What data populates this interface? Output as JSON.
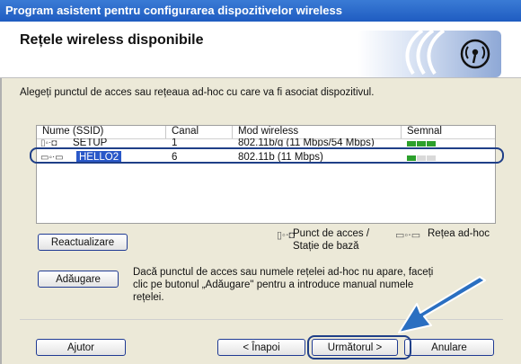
{
  "window": {
    "title": "Program asistent pentru configurarea dispozitivelor wireless"
  },
  "header": {
    "title": "Rețele wireless disponibile",
    "logo_icon": "wifi-broadcast-icon"
  },
  "instruction": "Alegeți punctul de acces sau rețeaua ad-hoc cu care va fi asociat dispozitivul.",
  "network_list": {
    "columns": [
      "Nume (SSID)",
      "Canal",
      "Mod wireless",
      "Semnal"
    ],
    "rows": [
      {
        "ssid": "SETUP",
        "channel": "1",
        "mode": "802.11b/g (11 Mbps/54 Mbps)",
        "signal_bars": 3,
        "type_icon": "access-point-icon"
      },
      {
        "ssid": "HELLO2",
        "channel": "6",
        "mode": "802.11b (11 Mbps)",
        "signal_bars": 1,
        "type_icon": "ad-hoc-icon",
        "selected": true
      }
    ]
  },
  "buttons": {
    "refresh": "Reactualizare",
    "add": "Adăugare",
    "help": "Ajutor",
    "back": "< Înapoi",
    "next": "Următorul >",
    "cancel": "Anulare"
  },
  "legend": {
    "access_point": "Punct de acces / Stație de bază",
    "ad_hoc": "Rețea ad-hoc"
  },
  "add_description": "Dacă punctul de acces sau numele rețelei ad-hoc nu apare, faceți clic pe butonul „Adăugare\" pentru a introduce manual numele rețelei.",
  "colors": {
    "accent": "#1f3f88",
    "title_bar": "#1f5cc1",
    "signal_on": "#2ca02c",
    "signal_off": "#d9d9d9"
  }
}
